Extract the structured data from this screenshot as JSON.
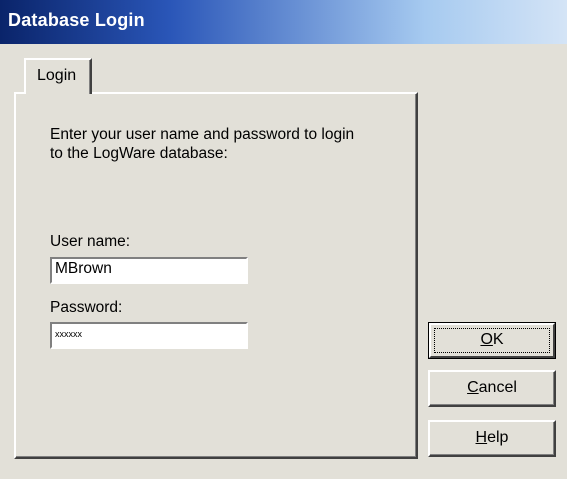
{
  "window": {
    "title": "Database Login"
  },
  "tab": {
    "label": "Login"
  },
  "login": {
    "intro": "Enter your user name and password to login\nto the LogWare database:",
    "user_label": "User name:",
    "user_value": "MBrown",
    "password_label": "Password:",
    "password_value": "xxxxxx"
  },
  "buttons": {
    "ok_mnemonic": "O",
    "ok_rest": "K",
    "cancel_mnemonic": "C",
    "cancel_rest": "ancel",
    "help_mnemonic": "H",
    "help_rest": "elp"
  },
  "colors": {
    "titlebar_start": "#0a246a",
    "titlebar_end": "#d4e4f6",
    "dialog_face": "#e2e0d8"
  }
}
